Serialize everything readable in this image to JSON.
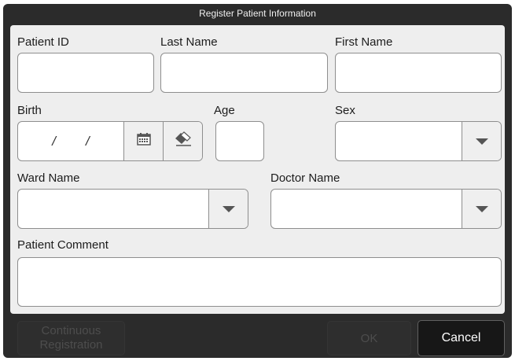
{
  "dialog": {
    "title": "Register Patient Information"
  },
  "form": {
    "patient_id": {
      "label": "Patient ID",
      "value": ""
    },
    "last_name": {
      "label": "Last Name",
      "value": ""
    },
    "first_name": {
      "label": "First Name",
      "value": ""
    },
    "birth": {
      "label": "Birth",
      "separator": "/",
      "value": ""
    },
    "age": {
      "label": "Age",
      "value": ""
    },
    "sex": {
      "label": "Sex",
      "value": ""
    },
    "ward_name": {
      "label": "Ward Name",
      "value": ""
    },
    "doctor_name": {
      "label": "Doctor Name",
      "value": ""
    },
    "patient_comment": {
      "label": "Patient Comment",
      "value": ""
    }
  },
  "footer": {
    "continuous_line1": "Continuous",
    "continuous_line2": "Registration",
    "ok_label": "OK",
    "cancel_label": "Cancel"
  },
  "icons": {
    "calendar": "calendar-icon",
    "eraser": "eraser-icon",
    "dropdown": "chevron-down-icon"
  },
  "colors": {
    "frame": "#2b2b2b",
    "panel": "#eeeeee",
    "field_border": "#8e8e8e",
    "disabled_text": "#4d4d4d"
  }
}
